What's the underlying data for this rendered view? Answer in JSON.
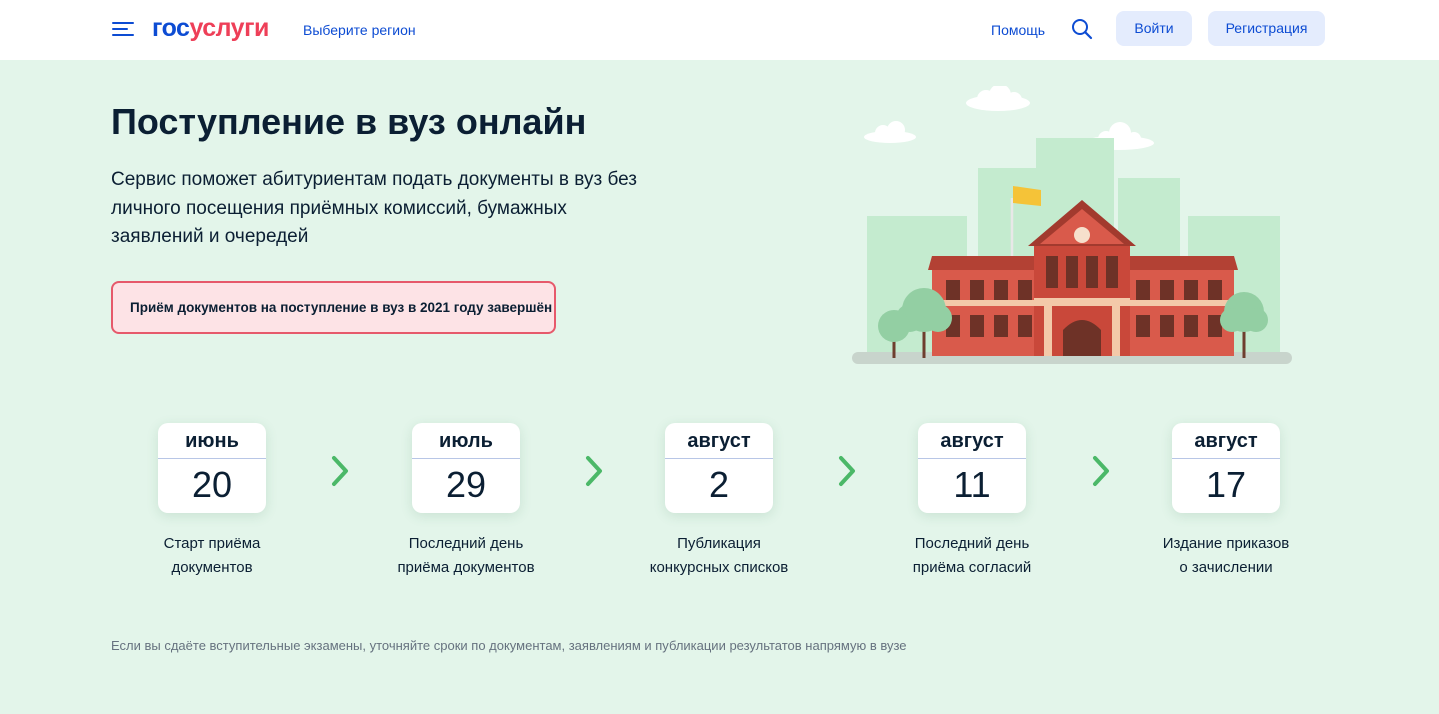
{
  "header": {
    "logo_part1": "гос",
    "logo_part2": "услуги",
    "region_link": "Выберите регион",
    "help_link": "Помощь",
    "login_button": "Войти",
    "register_button": "Регистрация"
  },
  "hero": {
    "title": "Поступление в вуз онлайн",
    "description": "Сервис поможет абитуриентам подать документы в вуз без личного посещения приёмных комиссий, бумажных заявлений и очередей",
    "alert": "Приём документов на поступление в вуз в 2021 году завершён"
  },
  "timeline": [
    {
      "month": "июнь",
      "day": "20",
      "label_line1": "Старт приёма",
      "label_line2": "документов"
    },
    {
      "month": "июль",
      "day": "29",
      "label_line1": "Последний день",
      "label_line2": "приёма документов"
    },
    {
      "month": "август",
      "day": "2",
      "label_line1": "Публикация",
      "label_line2": "конкурсных списков"
    },
    {
      "month": "август",
      "day": "11",
      "label_line1": "Последний день",
      "label_line2": "приёма согласий"
    },
    {
      "month": "август",
      "day": "17",
      "label_line1": "Издание приказов",
      "label_line2": "о зачислении"
    }
  ],
  "footnote": "Если вы сдаёте вступительные экзамены, уточняйте сроки по документам, заявлениям и публикации результатов напрямую в вузе",
  "colors": {
    "brand_blue": "#0d4cd3",
    "brand_red": "#ee3f58",
    "page_bg": "#e3f5ea",
    "alert_bg": "#fde3e6",
    "alert_border": "#e6596b",
    "arrow_green": "#4bb868"
  },
  "icons": {
    "menu": "burger-menu-icon",
    "search": "search-icon",
    "arrow": "chevron-right-icon"
  }
}
